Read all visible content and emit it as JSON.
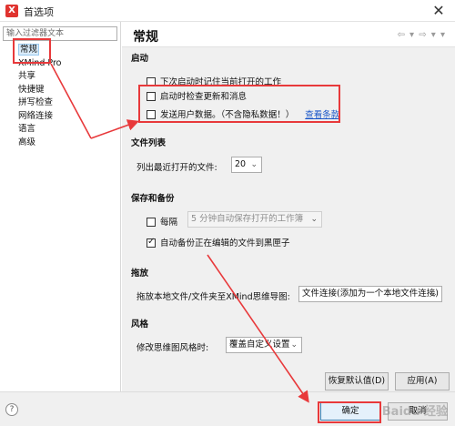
{
  "window": {
    "title": "首选项",
    "close_glyph": "✕",
    "app_icon_glyph": "X"
  },
  "sidebar": {
    "filter_placeholder": "输入过滤器文本",
    "items": [
      {
        "label": "常规",
        "selected": true
      },
      {
        "label": "XMind Pro"
      },
      {
        "label": "共享"
      },
      {
        "label": "快捷键"
      },
      {
        "label": "拼写检查"
      },
      {
        "label": "网络连接"
      },
      {
        "label": "语言"
      },
      {
        "label": "高级"
      }
    ]
  },
  "header": {
    "title": "常规",
    "nav_arrows": "⇦ ▾ ⇨ ▾ ▾"
  },
  "startup": {
    "section_title": "启动",
    "options": [
      {
        "label": "下次启动时记住当前打开的工作",
        "checked": false
      },
      {
        "label": "启动时检查更新和消息",
        "checked": false
      },
      {
        "label": "发送用户数据。（不含隐私数据！）",
        "checked": false,
        "link": "查看条款"
      }
    ]
  },
  "file_list": {
    "section_title": "文件列表",
    "recent_label": "列出最近打开的文件:",
    "recent_value": "20"
  },
  "save_backup": {
    "section_title": "保存和备份",
    "every_label": "每隔",
    "every_checked": false,
    "autosave_value": "5  分钟自动保存打开的工作簿",
    "backup_label": "自动备份正在编辑的文件到黑匣子",
    "backup_checked": true
  },
  "drag": {
    "section_title": "拖放",
    "label": "拖放本地文件/文件夹至XMind思维导图:",
    "value": "文件连接(添加为一个本地文件连接)"
  },
  "style": {
    "section_title": "风格",
    "label": "修改思维图风格时:",
    "value": "覆盖自定义设置"
  },
  "buttons": {
    "restore_defaults": "恢复默认值(D)",
    "apply": "应用(A)",
    "ok": "确定",
    "cancel": "取消"
  },
  "help_glyph": "?",
  "watermark": "Baidu 经验",
  "annotation_color": "#e8393b"
}
